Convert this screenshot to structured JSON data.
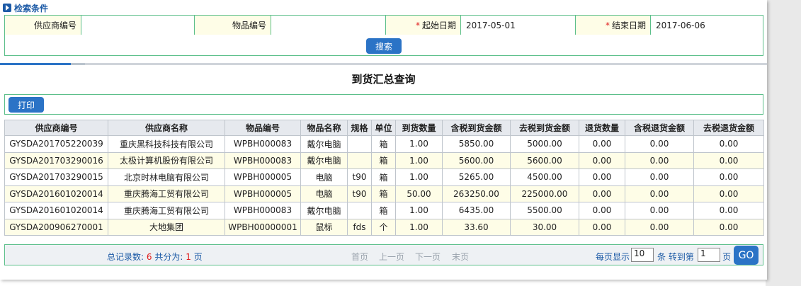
{
  "filter": {
    "section_title": "检索条件",
    "supplier_code_label": "供应商编号",
    "supplier_code_value": "",
    "item_code_label": "物品编号",
    "item_code_value": "",
    "required_mark": "*",
    "start_date_label": "起始日期",
    "start_date_value": "2017-05-01",
    "end_date_label": "结束日期",
    "end_date_value": "2017-06-06",
    "search_label": "搜索"
  },
  "report": {
    "title": "到货汇总查询",
    "print_label": "打印"
  },
  "table": {
    "headers": [
      "供应商编号",
      "供应商名称",
      "物品编号",
      "物品名称",
      "规格",
      "单位",
      "到货数量",
      "含税到货金额",
      "去税到货金额",
      "退货数量",
      "含税退货金额",
      "去税退货金额"
    ],
    "rows": [
      [
        "GYSDA201705220039",
        "重庆黑科技科技有限公司",
        "WPBH000083",
        "戴尔电脑",
        "",
        "箱",
        "1.00",
        "5850.00",
        "5000.00",
        "0.00",
        "0.00",
        "0.00"
      ],
      [
        "GYSDA201703290016",
        "太极计算机股份有限公司",
        "WPBH000083",
        "戴尔电脑",
        "",
        "箱",
        "1.00",
        "5600.00",
        "5600.00",
        "0.00",
        "0.00",
        "0.00"
      ],
      [
        "GYSDA201703290015",
        "北京时林电脑有限公司",
        "WPBH000005",
        "电脑",
        "t90",
        "箱",
        "1.00",
        "5265.00",
        "4500.00",
        "0.00",
        "0.00",
        "0.00"
      ],
      [
        "GYSDA201601020014",
        "重庆腾海工贸有限公司",
        "WPBH000005",
        "电脑",
        "t90",
        "箱",
        "50.00",
        "263250.00",
        "225000.00",
        "0.00",
        "0.00",
        "0.00"
      ],
      [
        "GYSDA201601020014",
        "重庆腾海工贸有限公司",
        "WPBH000083",
        "戴尔电脑",
        "",
        "箱",
        "1.00",
        "6435.00",
        "5500.00",
        "0.00",
        "0.00",
        "0.00"
      ],
      [
        "GYSDA200906270001",
        "大地集团",
        "WPBH00000001",
        "鼠标",
        "fds",
        "个",
        "1.00",
        "33.60",
        "30.00",
        "0.00",
        "0.00",
        "0.00"
      ]
    ]
  },
  "pager": {
    "total_label": "总记录数:",
    "total_value": "6",
    "pages_label": "共分为:",
    "pages_value": "1",
    "pages_unit": "页",
    "first": "首页",
    "prev": "上一页",
    "next": "下一页",
    "last": "末页",
    "per_page_label": "每页显示",
    "per_page_value": "10",
    "goto_label": "条 转到第",
    "goto_value": "1",
    "page_unit": "页",
    "go_label": "GO"
  },
  "colors": {
    "accent": "#2b73c6",
    "border_green": "#5cbf8a",
    "label_bg": "#fefde7",
    "header_bg": "#e6e9ee",
    "required_red": "#e02020"
  }
}
